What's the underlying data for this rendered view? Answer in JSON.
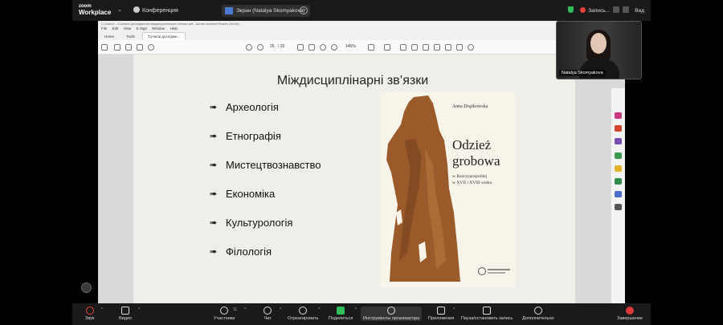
{
  "zoom": {
    "logo_line1": "zoom",
    "logo_line2": "Workplace",
    "meeting_label": "Конференция",
    "share_label": "Экран (Natalya Skomyakova)",
    "record_label": "Запись...",
    "view_label": "Вид"
  },
  "viewer": {
    "path": "C:/Users/.../Сучасні дослідження міждисциплінарні зв'язки.pdf - Adobe Acrobat Reader (64-bit)",
    "menu": [
      "File",
      "Edit",
      "View",
      "E-Sign",
      "Window",
      "Help"
    ],
    "tabs": [
      "Home",
      "Tools",
      "Сучасні дослідже..."
    ],
    "page_current": "26",
    "page_total": "/ 32",
    "zoom_level": "146%"
  },
  "slide": {
    "title": "Міждисциплінарні зв’язки",
    "bullets": [
      "Археологія",
      "Етнографія",
      "Мистецтвознавство",
      "Економіка",
      "Культурологія",
      "Філологія"
    ],
    "arrow_glyph": "➠"
  },
  "book": {
    "author": "Anna Drążkowska",
    "title_line1": "Odzież",
    "title_line2": "grobowa",
    "subtitle_line1": "w Rzeczypospolitej",
    "subtitle_line2": "w XVII i XVIII wieku"
  },
  "selfcam": {
    "name": "Natalya Skomyakova"
  },
  "bottom_bar": {
    "audio": "Звук",
    "video": "Видео",
    "participants": "Участники",
    "participants_count": "11",
    "chat": "Чат",
    "react": "Отреагировать",
    "share": "Поделиться",
    "host_tools": "Инструменты организатора",
    "apps": "Приложения",
    "record": "Пауза/остановить запись",
    "more": "Дополнительно",
    "end": "Завершение"
  },
  "colors": {
    "zoom_bg": "#1a1a1a",
    "slide_bg": "#efeee9",
    "share_green": "#2fbf5a",
    "end_red": "#d93b3b",
    "book_fabric": "#9b5a2a"
  }
}
